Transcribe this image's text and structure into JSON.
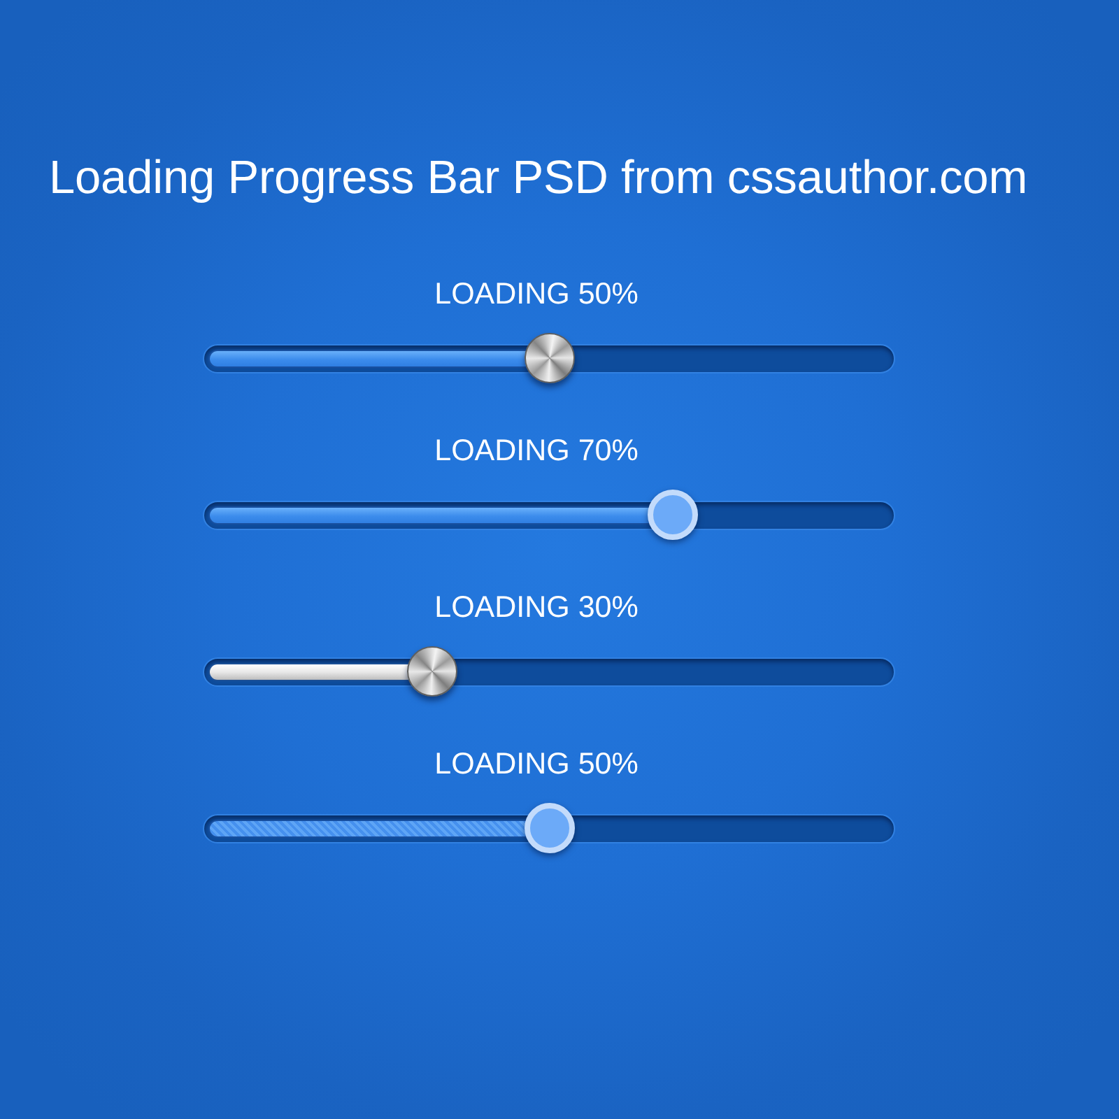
{
  "title": "Loading Progress Bar PSD from cssauthor.com",
  "bars": [
    {
      "label": "LOADING 50%",
      "level": 0.5,
      "thumb": {
        "kind": "metal"
      },
      "fill": {
        "kind": "blue"
      }
    },
    {
      "label": "LOADING 70%",
      "level": 0.68,
      "thumb": {
        "kind": "ring"
      },
      "fill": {
        "kind": "blue"
      }
    },
    {
      "label": "LOADING 30%",
      "level": 0.33,
      "thumb": {
        "kind": "metal"
      },
      "fill": {
        "kind": "silver"
      }
    },
    {
      "label": "LOADING 50%",
      "level": 0.5,
      "thumb": {
        "kind": "ring"
      },
      "fill": {
        "kind": "striped"
      }
    }
  ]
}
